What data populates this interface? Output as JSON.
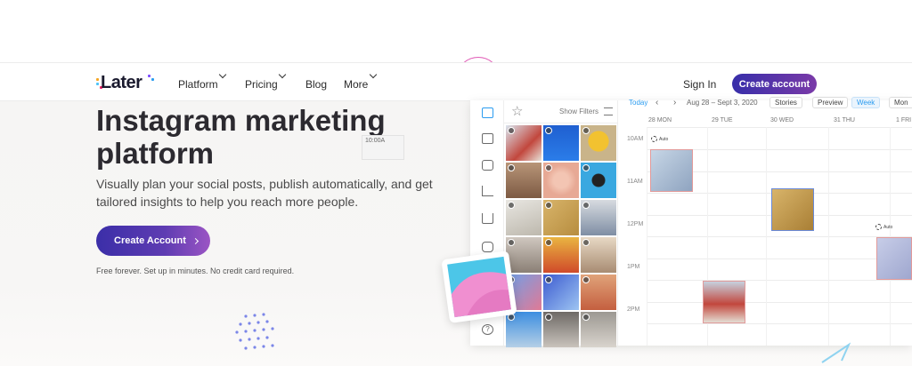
{
  "brand": {
    "name": "Later",
    "colors": {
      "primary": "#372ea9",
      "accent": "#9b55c4",
      "link": "#2b9cf0"
    }
  },
  "nav": {
    "items": [
      {
        "label": "Platform",
        "dropdown": true
      },
      {
        "label": "Pricing",
        "dropdown": true
      },
      {
        "label": "Blog",
        "dropdown": false
      },
      {
        "label": "More",
        "dropdown": true
      }
    ],
    "sign_in": "Sign In",
    "create_account": "Create account"
  },
  "hero": {
    "title_line1": "Instagram marketing",
    "title_line2": "platform",
    "subtitle": "Visually plan your social posts, publish automatically, and get tailored insights to help you reach more people.",
    "cta": "Create Account",
    "fine_print": "Free forever. Set up in minutes. No credit card required."
  },
  "app": {
    "media_bar": {
      "filters_label": "Show Filters"
    },
    "calendar": {
      "today": "Today",
      "range": "Aug 28 – Sept 3, 2020",
      "views": [
        "Stories",
        "Preview",
        "Week",
        "Mon"
      ],
      "selected_view": "Week",
      "days": [
        "28 MON",
        "29 TUE",
        "30 WED",
        "31 THU",
        "1 FRI"
      ],
      "hours": [
        "10AM",
        "11AM",
        "12PM",
        "1PM",
        "2PM"
      ],
      "auto_label": "Auto",
      "slot_time": "10:00A"
    },
    "rail_icons": [
      "calendar-icon",
      "media-icon",
      "conversations-icon",
      "analytics-icon",
      "download-icon",
      "instagram-icon",
      "help-icon"
    ],
    "help_glyph": "?"
  }
}
